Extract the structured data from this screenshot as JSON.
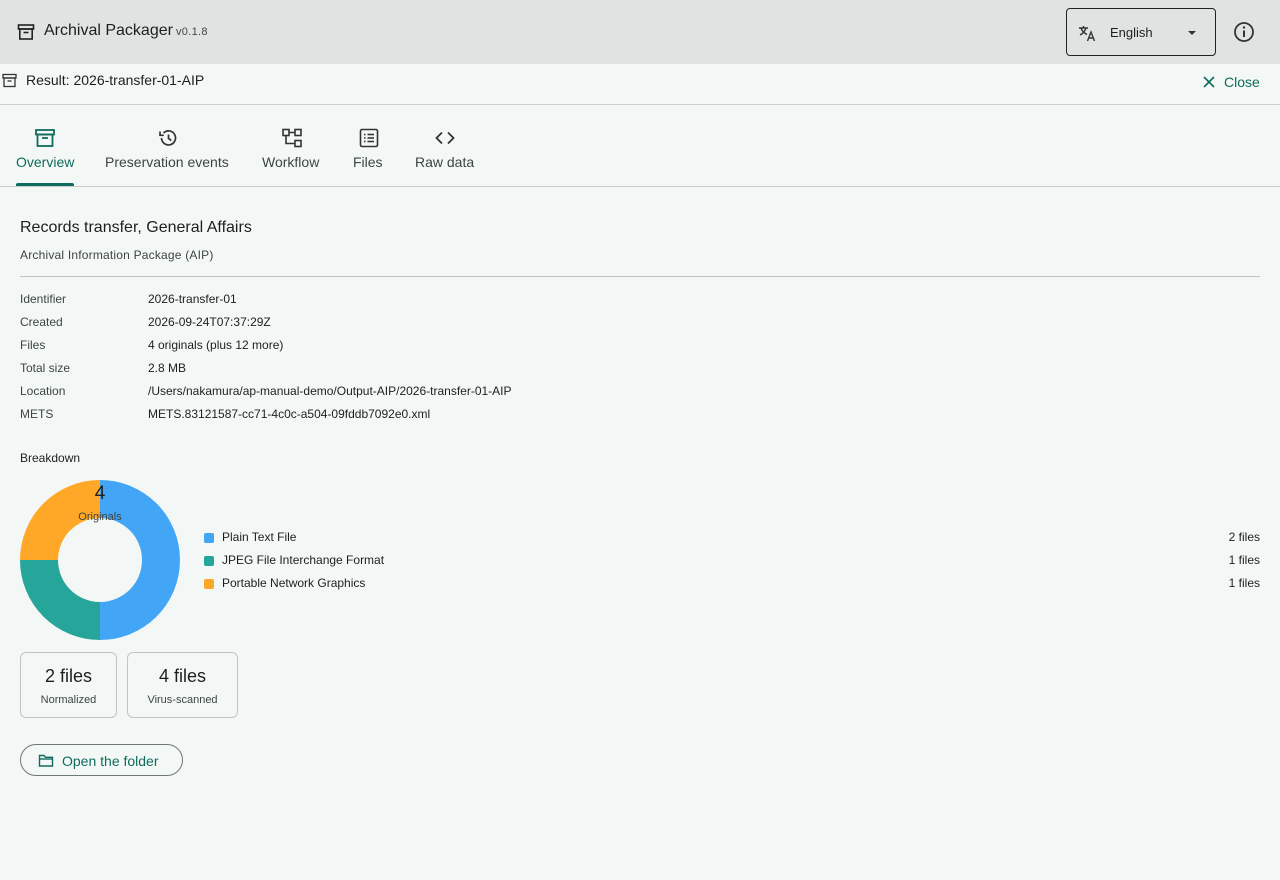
{
  "app": {
    "title": "Archival Packager",
    "version": "v0.1.8",
    "language": "English",
    "icons": {
      "logo": "archive-box-icon",
      "language": "translate-icon",
      "info": "info-icon"
    }
  },
  "result": {
    "title": "Result: 2026-transfer-01-AIP",
    "close_label": "Close"
  },
  "tabs": [
    {
      "label": "Overview",
      "icon": "archive-box-icon",
      "active": true
    },
    {
      "label": "Preservation events",
      "icon": "history-icon",
      "active": false
    },
    {
      "label": "Workflow",
      "icon": "workflow-icon",
      "active": false
    },
    {
      "label": "Files",
      "icon": "list-icon",
      "active": false
    },
    {
      "label": "Raw data",
      "icon": "code-icon",
      "active": false
    }
  ],
  "overview": {
    "title": "Records transfer, General Affairs",
    "subtitle": "Archival Information Package (AIP)",
    "metadata": [
      {
        "key": "Identifier",
        "value": "2026-transfer-01"
      },
      {
        "key": "Created",
        "value": "2026-09-24T07:37:29Z"
      },
      {
        "key": "Files",
        "value": "4 originals (plus 12 more)"
      },
      {
        "key": "Total size",
        "value": "2.8 MB"
      },
      {
        "key": "Location",
        "value": "/Users/nakamura/ap-manual-demo/Output-AIP/2026-transfer-01-AIP"
      },
      {
        "key": "METS",
        "value": "METS.83121587-cc71-4c0c-a504-09fddb7092e0.xml"
      }
    ],
    "breakdown_title": "Breakdown",
    "donut_count": "4",
    "donut_label": "Originals",
    "stats": [
      {
        "value": "2 files",
        "label": "Normalized"
      },
      {
        "value": "4 files",
        "label": "Virus-scanned"
      }
    ],
    "open_folder_label": "Open the folder"
  },
  "colors": {
    "accent": "#0f6b5c",
    "text_plain": "#42a5f5",
    "jpeg": "#26a69a",
    "png": "#ffa726"
  },
  "chart_data": {
    "type": "pie",
    "categories": [
      "Plain Text File",
      "JPEG File Interchange Format",
      "Portable Network Graphics"
    ],
    "values": [
      2,
      1,
      1
    ],
    "value_labels": [
      "2 files",
      "1 files",
      "1 files"
    ],
    "colors": [
      "#42a5f5",
      "#26a69a",
      "#ffa726"
    ],
    "center_value": "4",
    "center_label": "Originals"
  }
}
